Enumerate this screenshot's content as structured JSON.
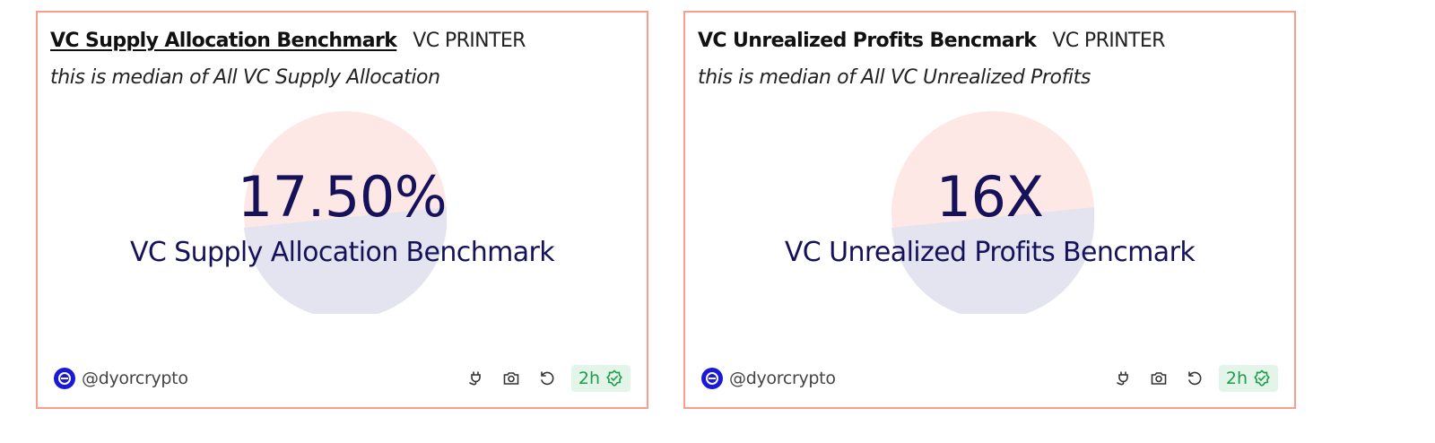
{
  "colors": {
    "border": "#f6a08c",
    "pie_top": "#fde8e6",
    "pie_bottom": "#e3e4ef",
    "value_text": "#15125a",
    "fresh_badge_bg": "#e3f5e8",
    "fresh_badge_text": "#1f9d4c",
    "avatar": "#1a1ad6"
  },
  "cards": [
    {
      "title": "VC Supply Allocation Benchmark",
      "publisher": "VC PRINTER",
      "subtitle": "this is median of All VC Supply Allocation",
      "value": "17.50%",
      "label": "VC Supply Allocation Benchmark",
      "author": "@dyorcrypto",
      "freshness": "2h",
      "icons": [
        "plug-icon",
        "camera-icon",
        "refresh-icon",
        "check-badge-icon"
      ]
    },
    {
      "title": "VC Unrealized Profits Bencmark",
      "publisher": "VC PRINTER",
      "subtitle": "this is median of All VC Unrealized Profits",
      "value": "16X",
      "label": "VC Unrealized Profits Bencmark",
      "author": "@dyorcrypto",
      "freshness": "2h",
      "icons": [
        "plug-icon",
        "camera-icon",
        "refresh-icon",
        "check-badge-icon"
      ]
    }
  ]
}
